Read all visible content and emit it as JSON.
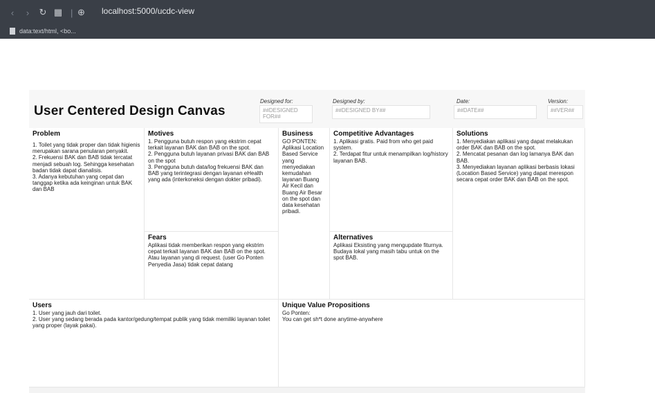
{
  "browser": {
    "url": "localhost:5000/ucdc-view",
    "tab_text": "data:text/html, <bo..."
  },
  "canvas": {
    "title": "User Centered Design Canvas",
    "meta": {
      "designed_for_label": "Designed for:",
      "designed_for_value": "##DESIGNED FOR##",
      "designed_by_label": "Designed by:",
      "designed_by_value": "##DESIGNED BY##",
      "date_label": "Date:",
      "date_value": "##DATE##",
      "version_label": "Version:",
      "version_value": "##VER##"
    },
    "sections": {
      "problem_title": "Problem",
      "problem_body": "1. Toilet yang tidak proper dan tidak higienis merupakan sarana penularan penyakit.\n2. Frekuensi BAK dan BAB tidak tercatat menjadi sebuah log. Sehingga kesehatan badan tidak dapat dianalisis.\n3. Adanya kebutuhan yang cepat dan tanggap ketika ada keinginan untuk BAK dan BAB",
      "motives_title": "Motives",
      "motives_body": "1. Pengguna butuh respon yang ekstrim cepat terkait layanan BAK dan BAB on the spot.\n2. Pengguna butuh layanan privasi BAK dan BAB on the spot\n3. Pengguna butuh data/log frekuensi BAK dan BAB yang terintegrasi dengan layanan eHealth yang ada (interkoneksi dengan dokter pribadi).",
      "fears_title": "Fears",
      "fears_body": "Aplikasi tidak memberikan respon yang ekstrim cepat terkait layanan BAK dan BAB on the spot. Atau layanan yang di request. (user Go Ponten Penyedia Jasa) tidak cepat datang",
      "business_title": "Business",
      "business_body": "GO PONTEN: Aplikasi Location Based Service yang menyediakan kemudahan layanan Buang Air Kecil dan Buang Air Besar on the spot dan data kesehatan pribadi.",
      "competitive_title": "Competitive Advantages",
      "competitive_body": "1. Aplikasi gratis. Paid from who get paid system.\n2. Terdapat fitur untuk menampilkan log/history layanan BAB.",
      "alternatives_title": "Alternatives",
      "alternatives_body": "Aplikasi Eksisting yang mengupdate fiturnya. Budaya lokal yang masih tabu untuk on the spot BAB.",
      "solutions_title": "Solutions",
      "solutions_body": "1. Menyediakan aplikasi yang dapat melakukan order BAK dan BAB on the spot.\n2. Mencatat pesanan dan log lamanya BAK dan BAB.\n3. Menyediakan layanan aplikasi berbasis lokasi (Location Based Service) yang dapat merespon secara cepat order BAK dan BAB on the spot.",
      "users_title": "Users",
      "users_body": "1. User yang jauh dari toilet.\n2. User yang sedang berada pada kantor/gedung/tempat publik yang tidak memiliki layanan toilet yang proper (layak pakai).",
      "uvp_title": "Unique Value Propositions",
      "uvp_body": "Go Ponten:\nYou can get sh*t done anytime-anywhere"
    }
  }
}
